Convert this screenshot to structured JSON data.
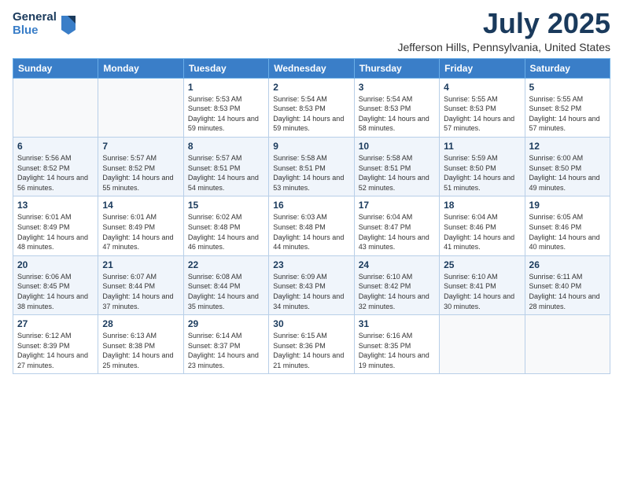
{
  "logo": {
    "general": "General",
    "blue": "Blue"
  },
  "title": {
    "month": "July 2025",
    "location": "Jefferson Hills, Pennsylvania, United States"
  },
  "calendar": {
    "headers": [
      "Sunday",
      "Monday",
      "Tuesday",
      "Wednesday",
      "Thursday",
      "Friday",
      "Saturday"
    ],
    "weeks": [
      [
        {
          "day": "",
          "info": ""
        },
        {
          "day": "",
          "info": ""
        },
        {
          "day": "1",
          "info": "Sunrise: 5:53 AM\nSunset: 8:53 PM\nDaylight: 14 hours and 59 minutes."
        },
        {
          "day": "2",
          "info": "Sunrise: 5:54 AM\nSunset: 8:53 PM\nDaylight: 14 hours and 59 minutes."
        },
        {
          "day": "3",
          "info": "Sunrise: 5:54 AM\nSunset: 8:53 PM\nDaylight: 14 hours and 58 minutes."
        },
        {
          "day": "4",
          "info": "Sunrise: 5:55 AM\nSunset: 8:53 PM\nDaylight: 14 hours and 57 minutes."
        },
        {
          "day": "5",
          "info": "Sunrise: 5:55 AM\nSunset: 8:52 PM\nDaylight: 14 hours and 57 minutes."
        }
      ],
      [
        {
          "day": "6",
          "info": "Sunrise: 5:56 AM\nSunset: 8:52 PM\nDaylight: 14 hours and 56 minutes."
        },
        {
          "day": "7",
          "info": "Sunrise: 5:57 AM\nSunset: 8:52 PM\nDaylight: 14 hours and 55 minutes."
        },
        {
          "day": "8",
          "info": "Sunrise: 5:57 AM\nSunset: 8:51 PM\nDaylight: 14 hours and 54 minutes."
        },
        {
          "day": "9",
          "info": "Sunrise: 5:58 AM\nSunset: 8:51 PM\nDaylight: 14 hours and 53 minutes."
        },
        {
          "day": "10",
          "info": "Sunrise: 5:58 AM\nSunset: 8:51 PM\nDaylight: 14 hours and 52 minutes."
        },
        {
          "day": "11",
          "info": "Sunrise: 5:59 AM\nSunset: 8:50 PM\nDaylight: 14 hours and 51 minutes."
        },
        {
          "day": "12",
          "info": "Sunrise: 6:00 AM\nSunset: 8:50 PM\nDaylight: 14 hours and 49 minutes."
        }
      ],
      [
        {
          "day": "13",
          "info": "Sunrise: 6:01 AM\nSunset: 8:49 PM\nDaylight: 14 hours and 48 minutes."
        },
        {
          "day": "14",
          "info": "Sunrise: 6:01 AM\nSunset: 8:49 PM\nDaylight: 14 hours and 47 minutes."
        },
        {
          "day": "15",
          "info": "Sunrise: 6:02 AM\nSunset: 8:48 PM\nDaylight: 14 hours and 46 minutes."
        },
        {
          "day": "16",
          "info": "Sunrise: 6:03 AM\nSunset: 8:48 PM\nDaylight: 14 hours and 44 minutes."
        },
        {
          "day": "17",
          "info": "Sunrise: 6:04 AM\nSunset: 8:47 PM\nDaylight: 14 hours and 43 minutes."
        },
        {
          "day": "18",
          "info": "Sunrise: 6:04 AM\nSunset: 8:46 PM\nDaylight: 14 hours and 41 minutes."
        },
        {
          "day": "19",
          "info": "Sunrise: 6:05 AM\nSunset: 8:46 PM\nDaylight: 14 hours and 40 minutes."
        }
      ],
      [
        {
          "day": "20",
          "info": "Sunrise: 6:06 AM\nSunset: 8:45 PM\nDaylight: 14 hours and 38 minutes."
        },
        {
          "day": "21",
          "info": "Sunrise: 6:07 AM\nSunset: 8:44 PM\nDaylight: 14 hours and 37 minutes."
        },
        {
          "day": "22",
          "info": "Sunrise: 6:08 AM\nSunset: 8:44 PM\nDaylight: 14 hours and 35 minutes."
        },
        {
          "day": "23",
          "info": "Sunrise: 6:09 AM\nSunset: 8:43 PM\nDaylight: 14 hours and 34 minutes."
        },
        {
          "day": "24",
          "info": "Sunrise: 6:10 AM\nSunset: 8:42 PM\nDaylight: 14 hours and 32 minutes."
        },
        {
          "day": "25",
          "info": "Sunrise: 6:10 AM\nSunset: 8:41 PM\nDaylight: 14 hours and 30 minutes."
        },
        {
          "day": "26",
          "info": "Sunrise: 6:11 AM\nSunset: 8:40 PM\nDaylight: 14 hours and 28 minutes."
        }
      ],
      [
        {
          "day": "27",
          "info": "Sunrise: 6:12 AM\nSunset: 8:39 PM\nDaylight: 14 hours and 27 minutes."
        },
        {
          "day": "28",
          "info": "Sunrise: 6:13 AM\nSunset: 8:38 PM\nDaylight: 14 hours and 25 minutes."
        },
        {
          "day": "29",
          "info": "Sunrise: 6:14 AM\nSunset: 8:37 PM\nDaylight: 14 hours and 23 minutes."
        },
        {
          "day": "30",
          "info": "Sunrise: 6:15 AM\nSunset: 8:36 PM\nDaylight: 14 hours and 21 minutes."
        },
        {
          "day": "31",
          "info": "Sunrise: 6:16 AM\nSunset: 8:35 PM\nDaylight: 14 hours and 19 minutes."
        },
        {
          "day": "",
          "info": ""
        },
        {
          "day": "",
          "info": ""
        }
      ]
    ]
  }
}
